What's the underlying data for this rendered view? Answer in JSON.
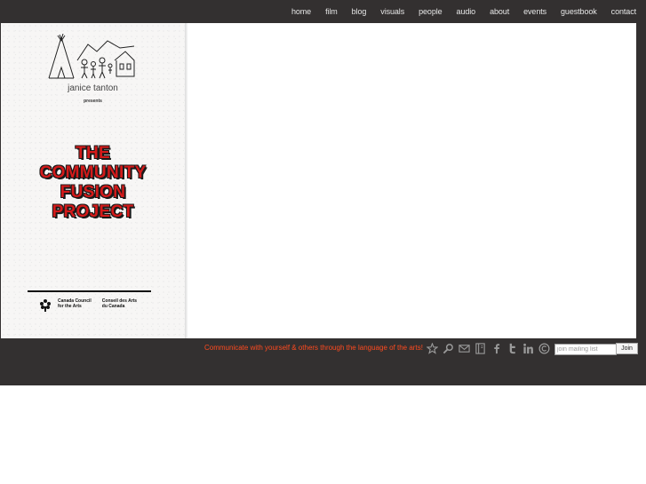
{
  "nav": {
    "items": [
      "home",
      "film",
      "blog",
      "visuals",
      "people",
      "audio",
      "about",
      "events",
      "guestbook",
      "contact"
    ]
  },
  "poster": {
    "artist": "janice tanton",
    "presents": "presents",
    "title_lines": [
      "THE",
      "COMMUNITY",
      "FUSION",
      "PROJECT"
    ],
    "council_en": [
      "Canada Council",
      "for the Arts"
    ],
    "council_fr": [
      "Conseil des Arts",
      "du Canada"
    ]
  },
  "footer": {
    "message": "Communicate with yourself & others through the language of the arts!",
    "icons": [
      "star-icon",
      "search-icon",
      "mail-icon",
      "bookmark-icon",
      "facebook-icon",
      "twitter-icon",
      "linkedin-icon",
      "copyright-icon"
    ],
    "mailing_placeholder": "join mailing list",
    "join_label": "Join"
  },
  "colors": {
    "background_band": "#333030",
    "message": "#ff4a1f",
    "title_red": "#d41a1a"
  }
}
